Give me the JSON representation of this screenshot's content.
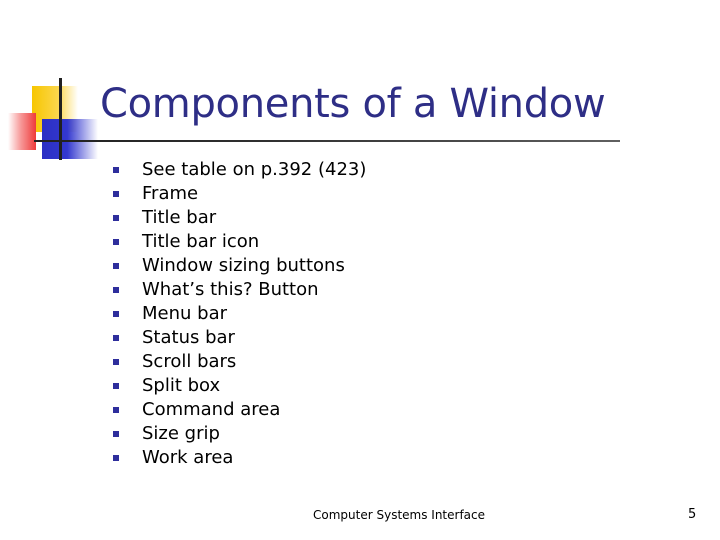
{
  "slide": {
    "title": "Components of a Window",
    "bullets": [
      "See table on p.392 (423)",
      "Frame",
      "Title bar",
      "Title bar icon",
      "Window sizing buttons",
      "What’s this? Button",
      "Menu bar",
      "Status bar",
      "Scroll bars",
      "Split box",
      "Command area",
      "Size grip",
      "Work area"
    ],
    "bullet_icon": "square-bullet-icon",
    "footer": "Computer Systems Interface",
    "page_number": "5"
  },
  "colors": {
    "title": "#2e2e86",
    "bullet": "#2e2e9c",
    "deco_yellow": "#f7c600",
    "deco_blue": "#2b2fc4",
    "deco_red": "#ee3b3b"
  }
}
